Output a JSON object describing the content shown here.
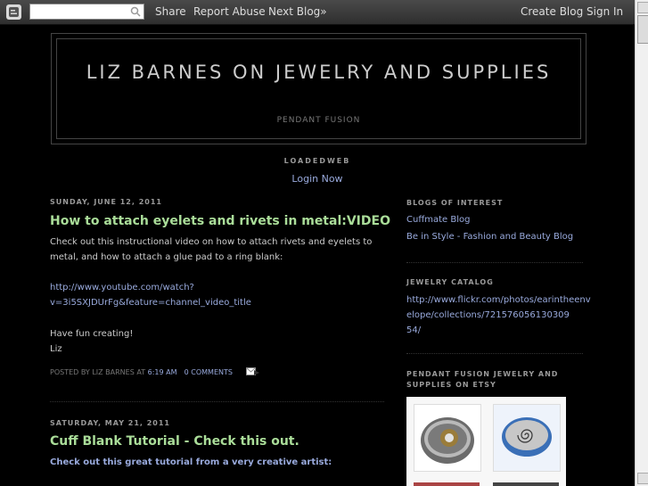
{
  "navbar": {
    "share": "Share",
    "report_abuse": "Report Abuse",
    "next_blog": "Next Blog»",
    "create_blog": "Create Blog",
    "sign_in": "Sign In"
  },
  "header": {
    "title": "LIZ BARNES ON JEWELRY AND SUPPLIES",
    "description": "PENDANT FUSION",
    "loaded": "LOADEDWEB",
    "login": "Login Now"
  },
  "posts": [
    {
      "date": "SUNDAY, JUNE 12, 2011",
      "title": "How to attach eyelets and rivets in metal:VIDEO",
      "body1": "Check out this instructional video on how to attach rivets and eyelets to metal, and how to attach a glue pad to a ring blank:",
      "url_line1": "http://www.youtube.com/watch?",
      "url_line2": "v=3i5SXJDUrFg&feature=channel_video_title",
      "body2": "Have fun creating!",
      "body3": "Liz",
      "footer_posted": "POSTED BY LIZ BARNES AT",
      "footer_time": "6:19 AM",
      "footer_comments": "0 COMMENTS"
    },
    {
      "date": "SATURDAY, MAY 21, 2011",
      "title": "Cuff Blank Tutorial - Check this out.",
      "body1": "Check out this great tutorial from a very creative artist:"
    }
  ],
  "sidebar": {
    "blogs_heading": "BLOGS OF INTEREST",
    "blogs": [
      "Cuffmate Blog",
      "Be in Style - Fashion and Beauty Blog"
    ],
    "catalog_heading": "JEWELRY CATALOG",
    "catalog_line1": "http://www.flickr.com/photos/earintheenv",
    "catalog_line2": "elope/collections/721576056130309",
    "catalog_line3": "54/",
    "etsy_heading_line1": "PENDANT FUSION JEWELRY AND",
    "etsy_heading_line2": "SUPPLIES ON ETSY"
  },
  "colors": {
    "background": "#000000",
    "post_title": "#aadd99",
    "link": "#99aadd",
    "text": "#cccccc",
    "muted": "#999999"
  }
}
